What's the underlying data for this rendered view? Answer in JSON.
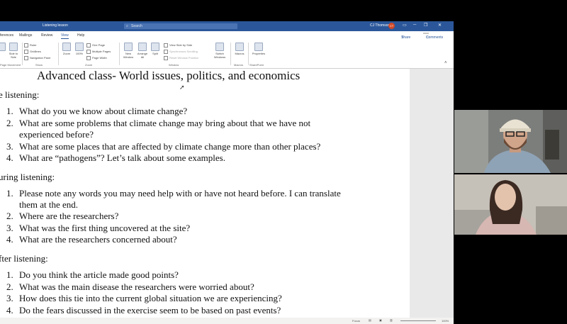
{
  "titlebar": {
    "doc_name": "Listening lesson",
    "search_placeholder": "Search",
    "user_name": "CJ Thomson",
    "user_initials": "CT"
  },
  "tabs": [
    "ferences",
    "Mailings",
    "Review",
    "View",
    "Help"
  ],
  "active_tab": "View",
  "share_label": "Share",
  "comments_label": "Comments",
  "ribbon": {
    "side_to_side": "Side to Side",
    "ruler": "Ruler",
    "gridlines": "Gridlines",
    "navigation_pane": "Navigation Pane",
    "zoom": "Zoom",
    "zoom_100": "100%",
    "one_page": "One Page",
    "multiple_pages": "Multiple Pages",
    "page_width": "Page Width",
    "new_window": "New Window",
    "arrange_all": "Arrange All",
    "split": "Split",
    "view_side_by_side": "View Side by Side",
    "synchronous_scrolling": "Synchronous Scrolling",
    "reset_window_position": "Reset Window Position",
    "switch_windows": "Switch Windows",
    "macros": "Macros",
    "properties": "Properties",
    "group_movement": "Page Movement",
    "group_show": "Show",
    "group_zoom": "Zoom",
    "group_window": "Window",
    "group_macros": "Macros",
    "group_sharepoint": "SharePoint"
  },
  "document": {
    "title": "Advanced class- World issues, politics, and economics",
    "sections": [
      {
        "header": "e listening:",
        "items": [
          "What do you we know about climate change?",
          "What are some problems that climate change may bring about that we have not",
          "experienced before?",
          "What are some places that are affected by climate change more than other places?",
          "What are “pathogens”? Let’s talk about some examples."
        ]
      },
      {
        "header": "uring listening:",
        "items": [
          "Please note any words you may need help with or have not heard before. I can translate",
          "them at the end.",
          "Where are the researchers?",
          "What was the first thing uncovered at the site?",
          "What are the researchers concerned about?"
        ]
      },
      {
        "header": "fter listening:",
        "items": [
          "Do you think the article made good points?",
          "What was the main disease the researchers were worried about?",
          "How does this tie into the current global situation we are experiencing?",
          "Do the fears discussed in the exercise seem to be based on past events?"
        ]
      }
    ],
    "numbers": [
      "1.",
      "2.",
      "3.",
      "4."
    ]
  },
  "status": {
    "focus": "Focus",
    "zoom": "100%"
  },
  "colors": {
    "brand": "#2b579a",
    "accent_avatar": "#d24726"
  }
}
